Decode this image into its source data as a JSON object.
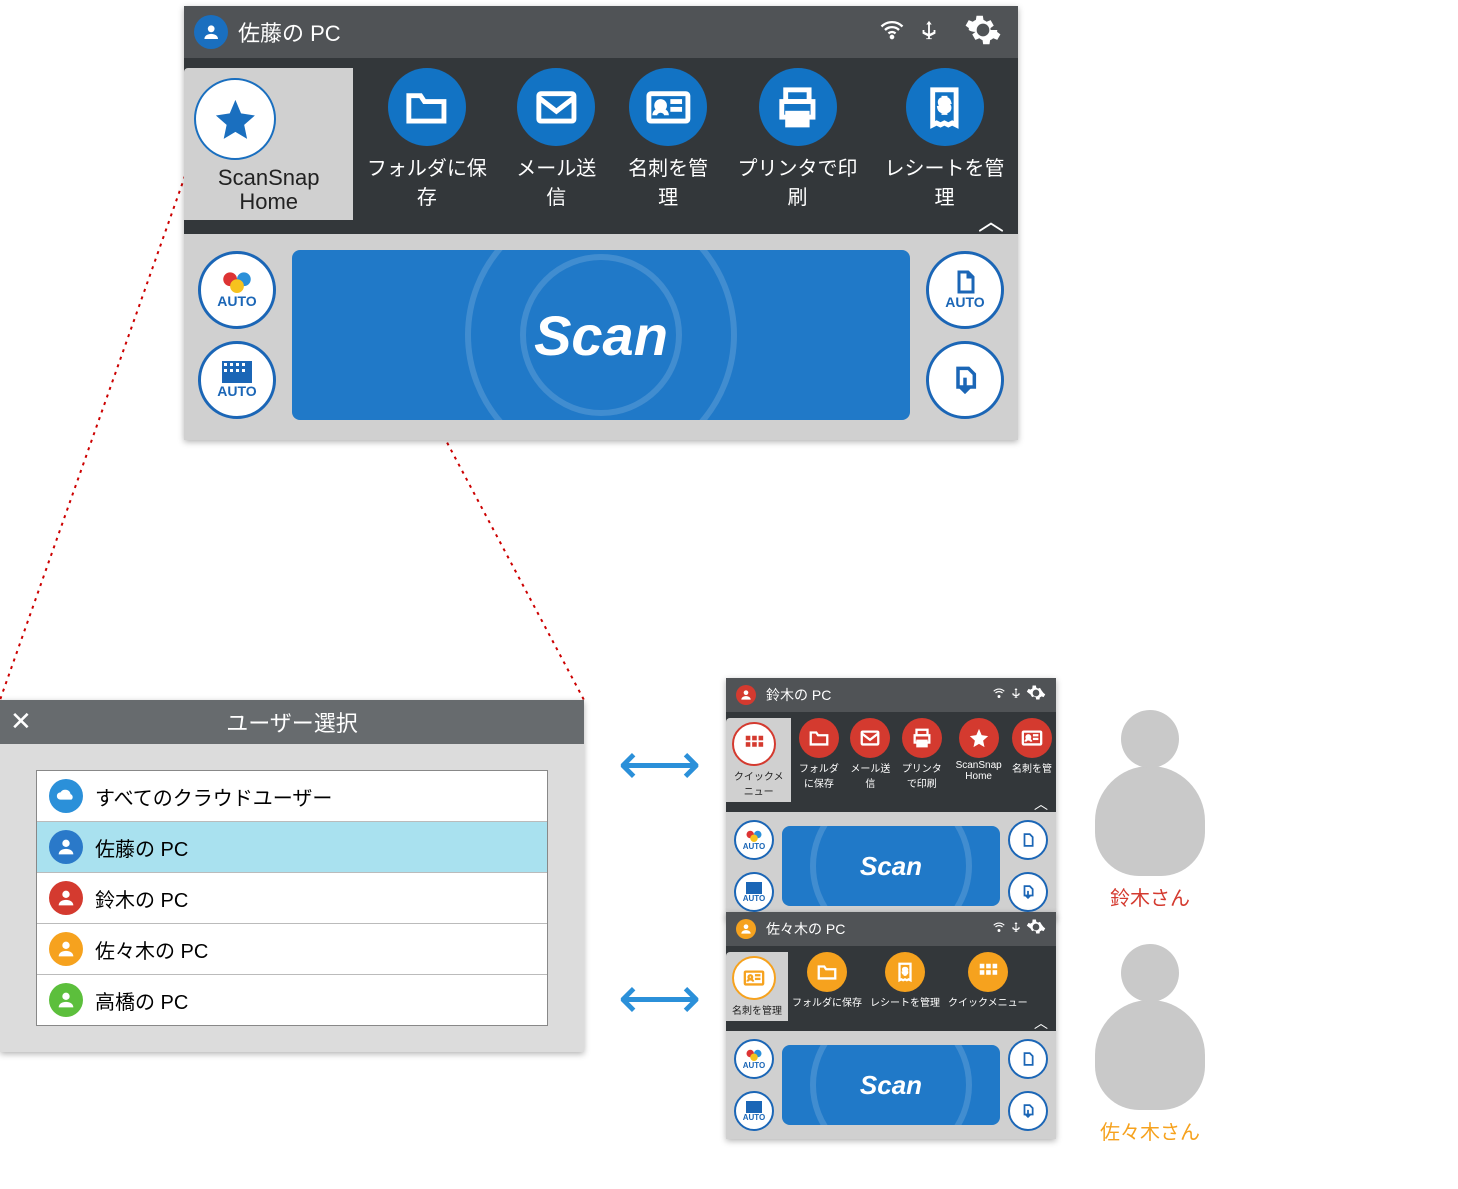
{
  "main_panel": {
    "user_title": "佐藤の PC",
    "home_label": "ScanSnap Home",
    "rail": [
      {
        "label": "フォルダに保存",
        "icon": "folder"
      },
      {
        "label": "メール送信",
        "icon": "mail"
      },
      {
        "label": "名刺を管理",
        "icon": "card"
      },
      {
        "label": "プリンタで印刷",
        "icon": "print"
      },
      {
        "label": "レシートを管理",
        "icon": "receipt"
      }
    ],
    "auto_label": "AUTO",
    "scan_label": "Scan"
  },
  "dialog": {
    "title": "ユーザー選択",
    "users": [
      {
        "label": "すべてのクラウドユーザー",
        "color": "cloud"
      },
      {
        "label": "佐藤の PC",
        "color": "blue",
        "selected": true
      },
      {
        "label": "鈴木の PC",
        "color": "red"
      },
      {
        "label": "佐々木の PC",
        "color": "orange"
      },
      {
        "label": "高橋の PC",
        "color": "green"
      }
    ]
  },
  "small_a": {
    "user_title": "鈴木の PC",
    "theme": "#d43a2f",
    "avatar_color": "#d43a2f",
    "home_label": "クイックメニュー",
    "home_icon": "grid",
    "rail": [
      {
        "label": "フォルダに保存",
        "icon": "folder"
      },
      {
        "label": "メール送信",
        "icon": "mail"
      },
      {
        "label": "プリンタで印刷",
        "icon": "print"
      },
      {
        "label": "ScanSnap Home",
        "icon": "star"
      },
      {
        "label": "名刺を管",
        "icon": "card"
      }
    ],
    "scan_label": "Scan",
    "auto_label": "AUTO",
    "person": "鈴木さん"
  },
  "small_b": {
    "user_title": "佐々木の PC",
    "theme": "#f6a21e",
    "avatar_color": "#f6a21e",
    "home_label": "名刺を管理",
    "home_icon": "card-outline",
    "rail": [
      {
        "label": "フォルダに保存",
        "icon": "folder"
      },
      {
        "label": "レシートを管理",
        "icon": "receipt"
      },
      {
        "label": "クイックメニュー",
        "icon": "grid"
      }
    ],
    "scan_label": "Scan",
    "auto_label": "AUTO",
    "person": "佐々木さん"
  }
}
